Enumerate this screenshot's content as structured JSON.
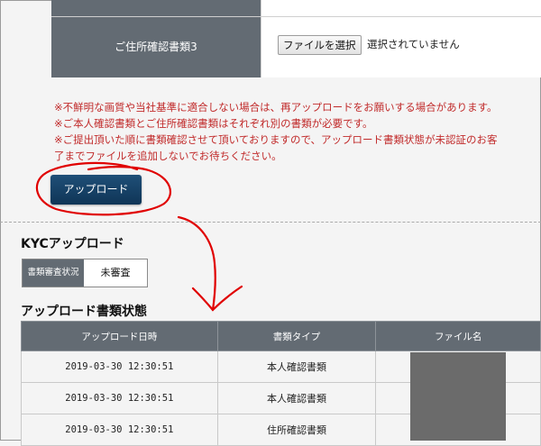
{
  "upload_form": {
    "row_label": "ご住所確認書類3",
    "file_button_label": "ファイルを選択",
    "file_status": "選択されていません"
  },
  "notes": [
    "※不鮮明な画質や当社基準に適合しない場合は、再アップロードをお願いする場合があります。",
    "※ご本人確認書類とご住所確認書類はそれぞれ別の書類が必要です。",
    "※ご提出頂いた順に書類確認させて頂いておりますので、アップロード書類状態が未認証のお客",
    "了までファイルを追加しないでお待ちください。"
  ],
  "upload_button_label": "アップロード",
  "kyc": {
    "title": "KYCアップロード",
    "status_label": "書類審査状況",
    "status_value": "未審査"
  },
  "documents": {
    "title": "アップロード書類状態",
    "headers": [
      "アップロード日時",
      "書類タイプ",
      "ファイル名"
    ],
    "rows": [
      {
        "datetime": "2019-03-30 12:30:51",
        "type": "本人確認書類",
        "file": ""
      },
      {
        "datetime": "2019-03-30 12:30:51",
        "type": "本人確認書類",
        "file": ""
      },
      {
        "datetime": "2019-03-30 12:30:51",
        "type": "住所確認書類",
        "file": ""
      }
    ]
  },
  "colors": {
    "header_bg": "#636b73",
    "note_text": "#c12b2b",
    "button_bg": "#15406a",
    "annotation": "#e00000"
  }
}
